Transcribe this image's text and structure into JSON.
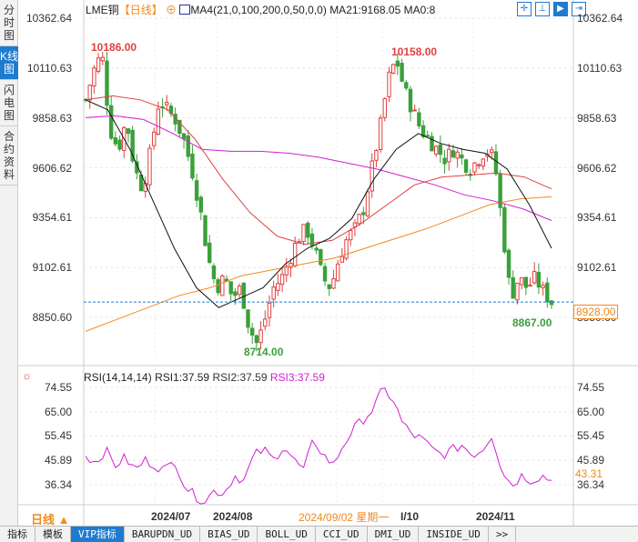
{
  "sidebar": {
    "tabs": [
      "分时图",
      "K线图",
      "闪电图",
      "合约资料"
    ],
    "active": 1
  },
  "header": {
    "symbol": "LME铜",
    "period": "【日线】",
    "ma_label": "MA4(21,0,100,200,0,50,0,0)",
    "ma21": "MA21:9168.05",
    "ma0": "MA0:8"
  },
  "toolbar": {
    "icons": [
      "crosshair-icon",
      "range-icon",
      "play-icon",
      "exit-icon"
    ]
  },
  "price_axis": [
    "10362.64",
    "10110.63",
    "9858.63",
    "9606.62",
    "9354.61",
    "9102.61",
    "8850.60"
  ],
  "current_price": "8928.00",
  "annotations": {
    "high1": "10186.00",
    "high2": "10158.00",
    "low1": "8714.00",
    "low2": "8867.00"
  },
  "rsi": {
    "label": "RSI(14,14,14)",
    "rsi1": "RSI1:37.59",
    "rsi2": "RSI2:37.59",
    "rsi3": "RSI3:37.59",
    "axis": [
      "74.55",
      "65.00",
      "55.45",
      "45.89",
      "36.34"
    ],
    "current": "43.31"
  },
  "period_button": "日线 ▲",
  "dates": [
    "2024/07",
    "2024/08",
    "I/10",
    "2024/11"
  ],
  "crosshair_date": "2024/09/02 星期一",
  "bottom_tabs": [
    "指标",
    "模板",
    "VIP指标",
    "BARUPDN_UD",
    "BIAS_UD",
    "BOLL_UD",
    "CCI_UD",
    "DMI_UD",
    "INSIDE_UD",
    ">>"
  ],
  "bottom_active": 2,
  "colors": {
    "up": "#e04040",
    "down": "#3aa03a",
    "accent": "#1e7bd0",
    "orange": "#f08a20"
  },
  "chart_data": {
    "type": "candlestick",
    "close_keypoints": [
      9950,
      10100,
      10186,
      9800,
      9700,
      9850,
      9600,
      9500,
      9700,
      9950,
      9900,
      9850,
      9750,
      9600,
      9400,
      9150,
      9000,
      9050,
      8950,
      9000,
      8800,
      8714,
      8850,
      9000,
      9050,
      9150,
      9250,
      9300,
      9200,
      9050,
      9000,
      9150,
      9250,
      9300,
      9400,
      9600,
      9800,
      10050,
      10158,
      10000,
      9900,
      9800,
      9750,
      9700,
      9650,
      9700,
      9650,
      9600,
      9650,
      9700,
      9650,
      9300,
      8950,
      9050,
      9000,
      9050,
      8980,
      8928
    ],
    "ma_black": [
      9950,
      9900,
      9700,
      9450,
      9200,
      9000,
      8900,
      8950,
      9000,
      9120,
      9200,
      9250,
      9350,
      9550,
      9700,
      9780,
      9730,
      9700,
      9680,
      9600,
      9420,
      9200
    ],
    "ma_red": [
      9950,
      9970,
      9950,
      9900,
      9750,
      9550,
      9380,
      9260,
      9220,
      9240,
      9320,
      9420,
      9520,
      9560,
      9570,
      9580,
      9560,
      9500
    ],
    "ma_magenta": [
      9860,
      9870,
      9850,
      9780,
      9700,
      9690,
      9690,
      9680,
      9660,
      9630,
      9600,
      9560,
      9520,
      9470,
      9440,
      9400,
      9340
    ],
    "ma_orange": [
      8780,
      8840,
      8900,
      8960,
      9000,
      9060,
      9090,
      9120,
      9150,
      9200,
      9250,
      9300,
      9360,
      9420,
      9450,
      9460
    ],
    "rsi_keypoints": [
      48,
      45,
      50,
      44,
      47,
      42,
      46,
      44,
      42,
      46,
      36,
      32,
      30,
      34,
      33,
      40,
      38,
      48,
      50,
      46,
      52,
      46,
      42,
      54,
      48,
      44,
      52,
      58,
      62,
      66,
      74,
      70,
      60,
      56,
      54,
      50,
      48,
      50,
      52,
      48,
      50,
      56,
      42,
      36,
      40,
      38,
      40,
      38
    ]
  }
}
